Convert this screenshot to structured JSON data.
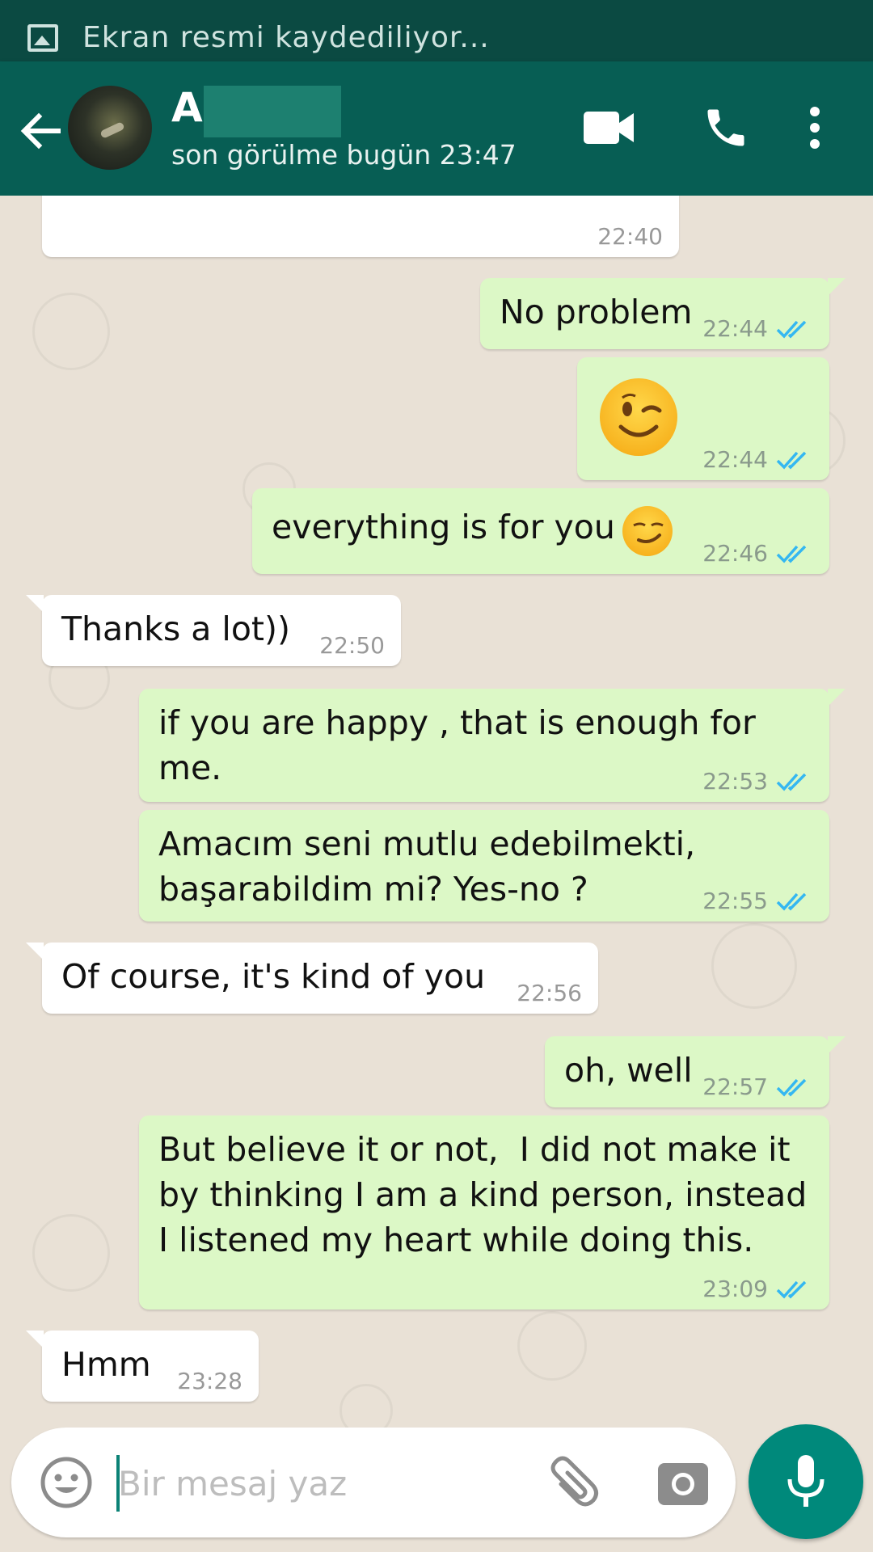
{
  "status_bar": {
    "notification": "Ekran resmi kaydediliyor..."
  },
  "header": {
    "contact_name": "A",
    "last_seen": "son görülme bugün 23:47"
  },
  "messages": [
    {
      "side": "in",
      "text": "",
      "time": "22:40"
    },
    {
      "side": "out",
      "text": "No problem",
      "time": "22:44",
      "status": "read"
    },
    {
      "side": "out",
      "text": "😉",
      "time": "22:44",
      "status": "read",
      "emoji": "winking-face"
    },
    {
      "side": "out",
      "text": "everything is for you",
      "time": "22:46",
      "status": "read",
      "emoji": "smirking-face"
    },
    {
      "side": "in",
      "text": "Thanks a lot))",
      "time": "22:50"
    },
    {
      "side": "out",
      "text": "if you are happy , that is enough for\nme.",
      "time": "22:53",
      "status": "read"
    },
    {
      "side": "out",
      "text": "Amacım seni mutlu edebilmekti,\nbaşarabildim mi? Yes-no ?",
      "time": "22:55",
      "status": "read"
    },
    {
      "side": "in",
      "text": "Of course, it's kind of you",
      "time": "22:56"
    },
    {
      "side": "out",
      "text": "oh, well",
      "time": "22:57",
      "status": "read"
    },
    {
      "side": "out",
      "text": "But believe it or not,  I did not make it\nby thinking I am a kind person, instead\nI listened my heart while doing this.",
      "time": "23:09",
      "status": "read"
    },
    {
      "side": "in",
      "text": "Hmm",
      "time": "23:28"
    }
  ],
  "input": {
    "placeholder": "Bir mesaj yaz",
    "value": ""
  },
  "colors": {
    "header": "#075e54",
    "outgoing": "#dcf8c6",
    "incoming": "#ffffff",
    "read_ticks": "#34b7f1",
    "fab": "#00897b"
  }
}
